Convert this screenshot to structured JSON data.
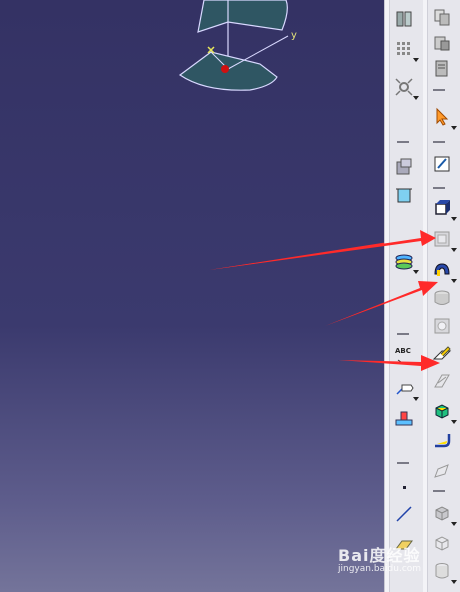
{
  "viewport": {
    "axis_y_label": "y",
    "axis_x_label": "x"
  },
  "colors": {
    "accent_arrow": "#ff2a2a",
    "toolbar_bg": "#e6e6ec",
    "viewport_top": "#343264",
    "viewport_bottom": "#74749a"
  },
  "toolbar": {
    "left_column": [
      {
        "name": "view-rotate-icon"
      },
      {
        "name": "grid-icon"
      },
      {
        "name": "fit-all-icon"
      },
      {
        "name": "constraint-icon"
      },
      {
        "name": "dimension-box-icon"
      },
      {
        "name": "layers-icon"
      },
      {
        "name": "text-annotation-icon",
        "label": "ABC"
      },
      {
        "name": "flag-note-icon"
      },
      {
        "name": "measure-icon"
      },
      {
        "name": "point-icon"
      },
      {
        "name": "line-icon"
      },
      {
        "name": "plane-icon"
      }
    ],
    "right_column": [
      {
        "name": "copy-icon"
      },
      {
        "name": "paste-icon"
      },
      {
        "name": "document-icon"
      },
      {
        "name": "select-arrow-icon"
      },
      {
        "name": "sketch-icon"
      },
      {
        "name": "pad-icon"
      },
      {
        "name": "pocket-icon"
      },
      {
        "name": "shaft-icon"
      },
      {
        "name": "groove-icon"
      },
      {
        "name": "hole-icon"
      },
      {
        "name": "rib-icon"
      },
      {
        "name": "slot-icon"
      },
      {
        "name": "solid-combine-icon"
      },
      {
        "name": "fillet-icon"
      },
      {
        "name": "draft-icon"
      },
      {
        "name": "shell-icon"
      },
      {
        "name": "box-icon"
      },
      {
        "name": "cylinder-icon"
      }
    ]
  },
  "watermark": {
    "main": "Bai度经验",
    "sub": "jingyan.baidu.com"
  }
}
